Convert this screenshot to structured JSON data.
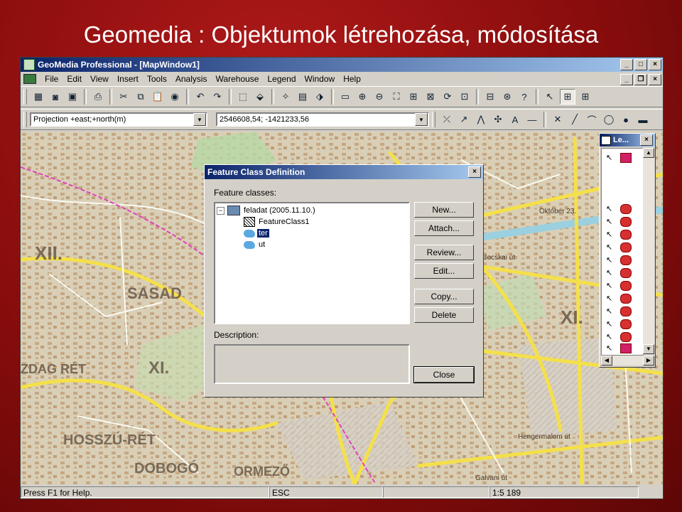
{
  "slide": {
    "title": "Geomedia : Objektumok létrehozása, módosítása"
  },
  "window": {
    "title": "GeoMedia Professional - [MapWindow1]"
  },
  "menu": [
    "File",
    "Edit",
    "View",
    "Insert",
    "Tools",
    "Analysis",
    "Warehouse",
    "Legend",
    "Window",
    "Help"
  ],
  "toolbar2": {
    "projection_value": "Projection +east;+north(m)",
    "coordinate_value": "2546608,54; -1421233,56"
  },
  "map": {
    "labels": [
      "SASAD",
      "XII.",
      "XI.",
      "HOSSZÚ-RÉT",
      "DOBOGÓ",
      "ORMEZŐ",
      "ZDAG RÉT",
      "Október 23.",
      "Bocskai út",
      "Hengermalom út",
      "Galvani út",
      "XI."
    ]
  },
  "dialog": {
    "title": "Feature Class Definition",
    "feature_classes_label": "Feature classes:",
    "tree": {
      "root": "feladat (2005.11.10.)",
      "children": [
        "FeatureClass1",
        "ter",
        "ut"
      ],
      "selected": "ter"
    },
    "description_label": "Description:",
    "buttons": {
      "new": "New...",
      "attach": "Attach...",
      "review": "Review...",
      "edit": "Edit...",
      "copy": "Copy...",
      "delete": "Delete",
      "close": "Close"
    }
  },
  "legend_panel": {
    "title": "Le..."
  },
  "status": {
    "help": "Press F1 for Help.",
    "key": "ESC",
    "scale": "1:5 189"
  }
}
